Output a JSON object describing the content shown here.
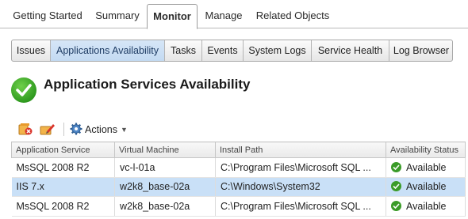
{
  "top_tabs": [
    {
      "label": "Getting Started",
      "active": false
    },
    {
      "label": "Summary",
      "active": false
    },
    {
      "label": "Monitor",
      "active": true
    },
    {
      "label": "Manage",
      "active": false
    },
    {
      "label": "Related Objects",
      "active": false
    }
  ],
  "sub_tabs": [
    {
      "label": "Issues",
      "active": false
    },
    {
      "label": "Applications Availability",
      "active": true
    },
    {
      "label": "Tasks",
      "active": false
    },
    {
      "label": "Events",
      "active": false
    },
    {
      "label": "System Logs",
      "active": false
    },
    {
      "label": "Service Health",
      "active": false
    },
    {
      "label": "Log Browser",
      "active": false
    }
  ],
  "page": {
    "title": "Application Services Availability",
    "title_icon": "green-check-icon"
  },
  "toolbar": {
    "icons": [
      "remove-service-icon",
      "edit-service-icon"
    ],
    "actions_label": "Actions",
    "actions_icon": "gear-icon"
  },
  "table": {
    "columns": [
      "Application Service",
      "Virtual Machine",
      "Install Path",
      "Availability Status"
    ],
    "rows": [
      {
        "service": "MsSQL 2008 R2",
        "vm": "vc-l-01a",
        "path": "C:\\Program Files\\Microsoft SQL ...",
        "status": "Available",
        "selected": false
      },
      {
        "service": "IIS 7.x",
        "vm": "w2k8_base-02a",
        "path": "C:\\Windows\\System32",
        "status": "Available",
        "selected": true
      },
      {
        "service": "MsSQL 2008 R2",
        "vm": "w2k8_base-02a",
        "path": "C:\\Program Files\\Microsoft SQL ...",
        "status": "Available",
        "selected": false
      }
    ]
  },
  "colors": {
    "selected_row": "#c9e0f7",
    "active_subtab": "#c3daf2",
    "status_ok": "#3a9b28"
  }
}
